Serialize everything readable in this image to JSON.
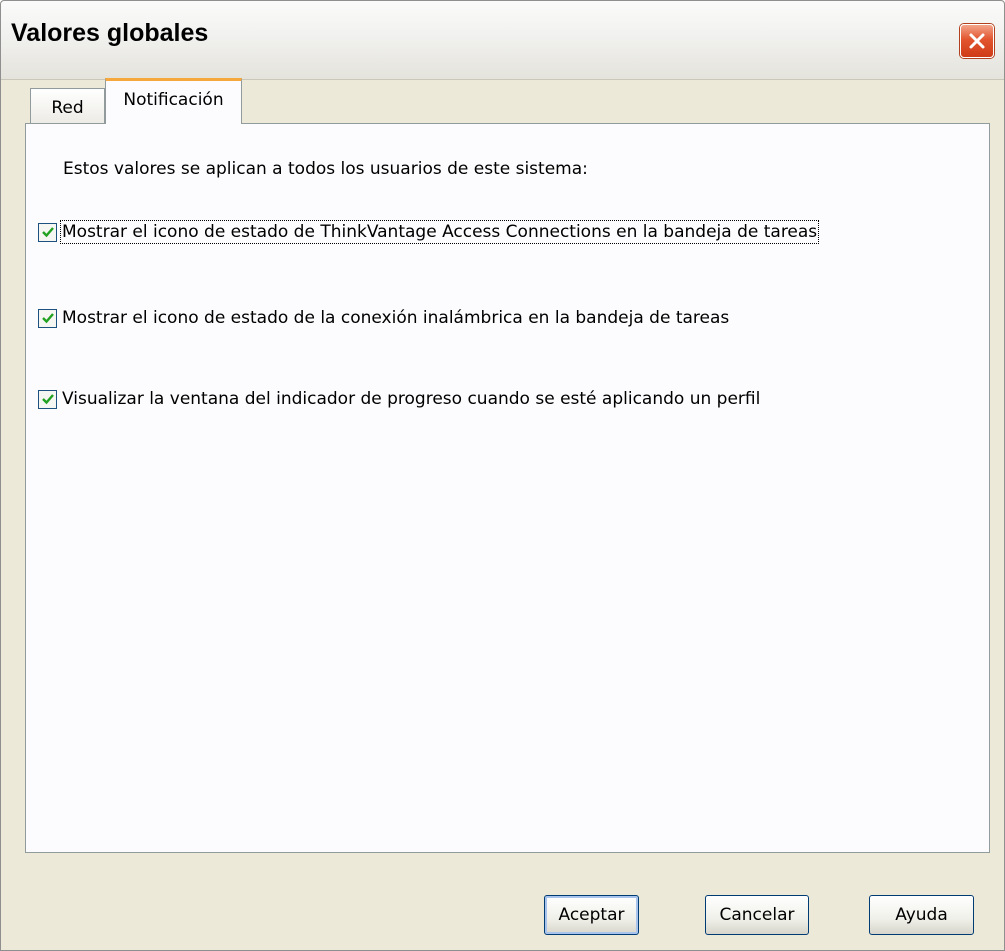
{
  "window": {
    "title": "Valores globales"
  },
  "tabs": [
    {
      "label": "Red",
      "selected": false
    },
    {
      "label": "Notificación",
      "selected": true
    }
  ],
  "content": {
    "intro": "Estos valores se aplican a todos los usuarios de este sistema:",
    "checkboxes": [
      {
        "label": "Mostrar el icono de estado de ThinkVantage Access Connections en la bandeja de tareas",
        "checked": true
      },
      {
        "label": "Mostrar el icono de estado de la conexión inalámbrica en la bandeja de tareas",
        "checked": true
      },
      {
        "label": "Visualizar la ventana del indicador de progreso cuando se esté aplicando un perfil",
        "checked": true
      }
    ]
  },
  "buttons": {
    "ok": "Aceptar",
    "cancel": "Cancelar",
    "help": "Ayuda"
  },
  "colors": {
    "dialog_bg": "#ECE9D8",
    "panel_bg": "#FCFCFE",
    "close_button": "#E2552F",
    "active_tab_accent": "#F7A83C",
    "checkmark": "#21A121"
  },
  "icons": {
    "close": "close-icon",
    "check": "check-icon"
  }
}
